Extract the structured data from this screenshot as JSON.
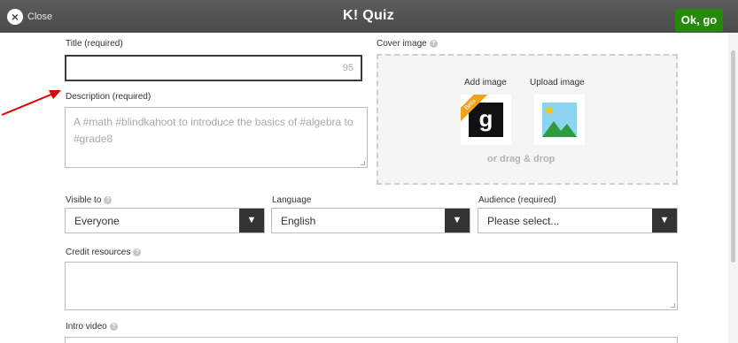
{
  "header": {
    "close_label": "Close",
    "close_icon": "×",
    "brand": "K! Quiz",
    "ok_label": "Ok, go",
    "ok_color": "#26890c"
  },
  "form": {
    "title_label": "Title (required)",
    "title_value": "",
    "title_remaining": "95",
    "description_label": "Description (required)",
    "description_placeholder": "A #math #blindkahoot to introduce the basics of #algebra to #grade8",
    "cover_label": "Cover image",
    "add_image_label": "Add image",
    "upload_image_label": "Upload image",
    "beta_badge": "Beta",
    "g_letter": "g",
    "drag_drop": "or drag & drop",
    "visible_label": "Visible to",
    "visible_value": "Everyone",
    "language_label": "Language",
    "language_value": "English",
    "audience_label": "Audience (required)",
    "audience_value": "Please select...",
    "credit_label": "Credit resources",
    "intro_label": "Intro video",
    "help_glyph": "?",
    "dropdown_glyph": "▼"
  },
  "annotation": {
    "arrow_color": "#e00000"
  }
}
